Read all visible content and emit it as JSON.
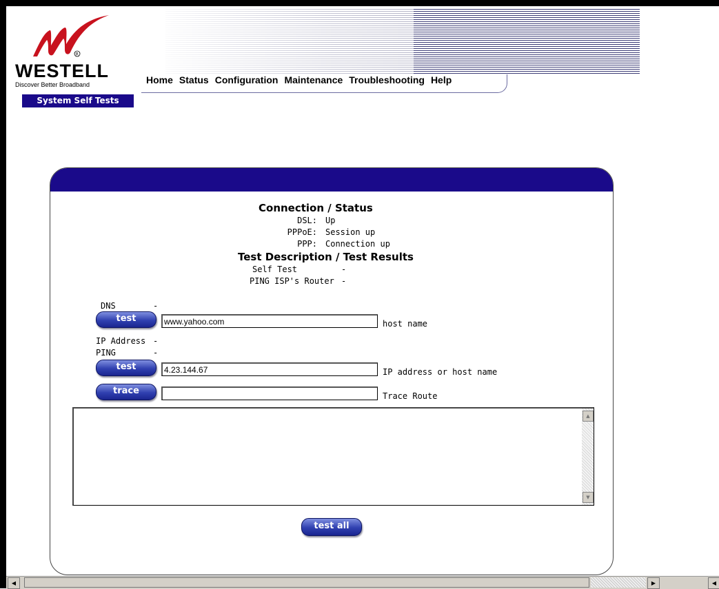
{
  "brand": {
    "name": "WESTELL",
    "tagline": "Discover Better Broadband"
  },
  "nav": [
    "Home",
    "Status",
    "Configuration",
    "Maintenance",
    "Troubleshooting",
    "Help"
  ],
  "section_tab": "System Self Tests",
  "connection": {
    "title": "Connection / Status",
    "rows": [
      {
        "label": "DSL:",
        "value": "Up"
      },
      {
        "label": "PPPoE:",
        "value": "Session up"
      },
      {
        "label": "PPP:",
        "value": "Connection up"
      }
    ]
  },
  "tests": {
    "title": "Test Description / Test Results",
    "self_test_label": "Self Test",
    "self_test_result": "-",
    "ping_router_label": "PING ISP's Router",
    "ping_router_result": "-"
  },
  "dns": {
    "label": "DNS",
    "result": "-",
    "button": "test",
    "input_value": "www.yahoo.com",
    "hint": "host name"
  },
  "ip_address": {
    "label": "IP Address",
    "result": "-"
  },
  "ping": {
    "label": "PING",
    "result": "-",
    "button": "test",
    "input_value": "4.23.144.67",
    "hint": "IP address or host name"
  },
  "trace": {
    "button": "trace",
    "input_value": "",
    "hint": "Trace Route"
  },
  "output_text": "",
  "test_all_button": "test all",
  "colors": {
    "accent": "#1a0a8a",
    "button_blue": "#3040b0",
    "logo_red": "#c8121e"
  }
}
